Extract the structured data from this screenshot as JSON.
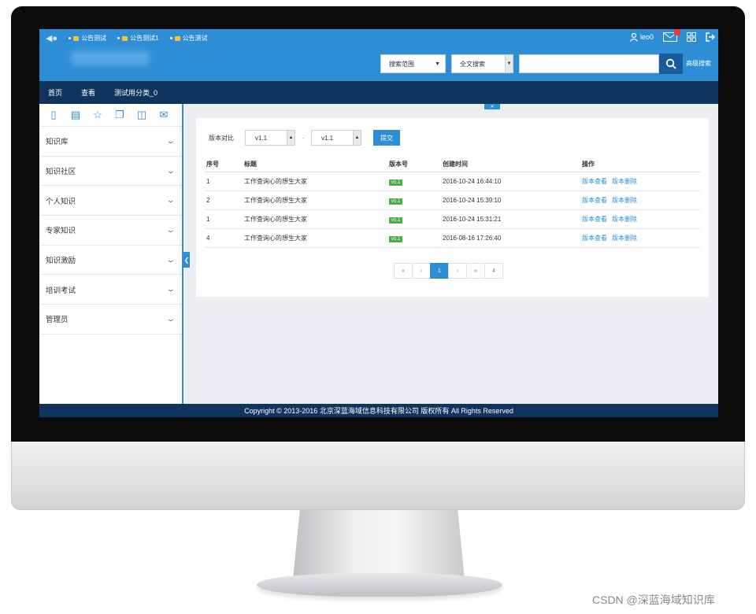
{
  "topbar": {
    "tabs": [
      "公告测试",
      "公告测试1",
      "公告测试"
    ],
    "username": "leo0"
  },
  "search": {
    "scope_label": "搜索范围",
    "type_label": "全文搜索",
    "query_value": "",
    "advanced_label": "高级搜索"
  },
  "nav": {
    "items": [
      "首页",
      "查看",
      "测试用分类_0"
    ]
  },
  "sidebar": {
    "tools": [
      "doc-icon",
      "doc-view-icon",
      "star-icon",
      "copy-icon",
      "stack-icon",
      "mail-icon"
    ],
    "items": [
      "知识库",
      "知识社区",
      "个人知识",
      "专家知识",
      "知识激励",
      "培训考试",
      "管理员"
    ]
  },
  "filter": {
    "label": "版本对比",
    "version_a": "v1.1",
    "version_b": "v1.1",
    "submit_label": "提交"
  },
  "table": {
    "headers": [
      "序号",
      "标题",
      "版本号",
      "创建时间",
      "操作"
    ],
    "rows": [
      {
        "no": "1",
        "title": "工作查询心的想生大家",
        "version": "v1.1",
        "created": "2016-10-24 16:44:10",
        "op1": "版本查看",
        "op2": "版本删除"
      },
      {
        "no": "2",
        "title": "工作查询心的想生大家",
        "version": "v1.1",
        "created": "2016-10-24 15:39:10",
        "op1": "版本查看",
        "op2": "版本删除"
      },
      {
        "no": "1",
        "title": "工作查询心的想生大家",
        "version": "v1.1",
        "created": "2016-10-24 15:31:21",
        "op1": "版本查看",
        "op2": "版本删除"
      },
      {
        "no": "4",
        "title": "工作查询心的想生大家",
        "version": "v1.1",
        "created": "2016-08-16 17:26:40",
        "op1": "版本查看",
        "op2": "版本删除"
      }
    ]
  },
  "pager": {
    "first": "«",
    "prev": "‹",
    "current": "1",
    "next": "›",
    "last": "»",
    "total": "4"
  },
  "footer": {
    "text": "Copyright © 2013-2016 北京深蓝海域信息科技有限公司 版权所有 All Rights Reserved"
  },
  "watermark": "CSDN @深蓝海域知识库",
  "colors": {
    "accent": "#2d8ed6",
    "navy": "#0f355f",
    "badge": "#4cae4c"
  }
}
